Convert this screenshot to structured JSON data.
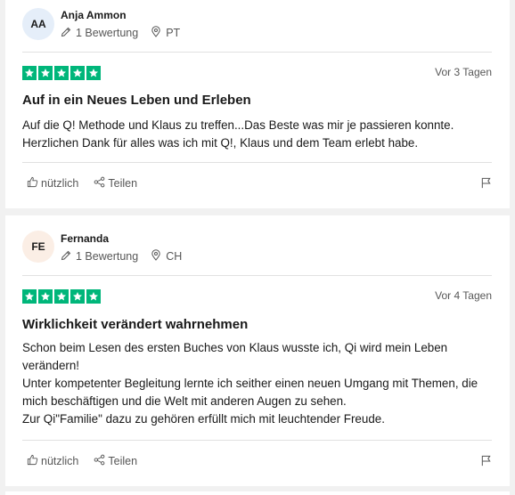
{
  "reviews": [
    {
      "initials": "AA",
      "avatar_bg": "#e5eef9",
      "name": "Anja Ammon",
      "review_count": "1 Bewertung",
      "country": "PT",
      "rating": 5,
      "date": "Vor 3 Tagen",
      "title": "Auf in ein Neues Leben und Erleben",
      "body": [
        "Auf die Q! Methode und Klaus zu treffen...Das Beste was mir je passieren konnte.",
        "Herzlichen Dank für alles was ich mit Q!, Klaus und dem Team erlebt habe."
      ],
      "useful_label": "nützlich",
      "share_label": "Teilen"
    },
    {
      "initials": "FE",
      "avatar_bg": "#fbeee5",
      "name": "Fernanda",
      "review_count": "1 Bewertung",
      "country": "CH",
      "rating": 5,
      "date": "Vor 4 Tagen",
      "title": "Wirklichkeit verändert wahrnehmen",
      "body": [
        "Schon beim Lesen des ersten Buches von Klaus wusste ich, Qi wird mein Leben verändern!",
        "Unter kompetenter Begleitung lernte ich seither einen neuen Umgang mit Themen, die mich beschäftigen und die Welt mit anderen Augen zu sehen.",
        "Zur Qi\"Familie\" dazu zu gehören erfüllt mich mit leuchtender Freude."
      ],
      "useful_label": "nützlich",
      "share_label": "Teilen"
    }
  ],
  "colors": {
    "star": "#00b67a",
    "muted": "#575757",
    "separator": "#e1e1e1"
  }
}
